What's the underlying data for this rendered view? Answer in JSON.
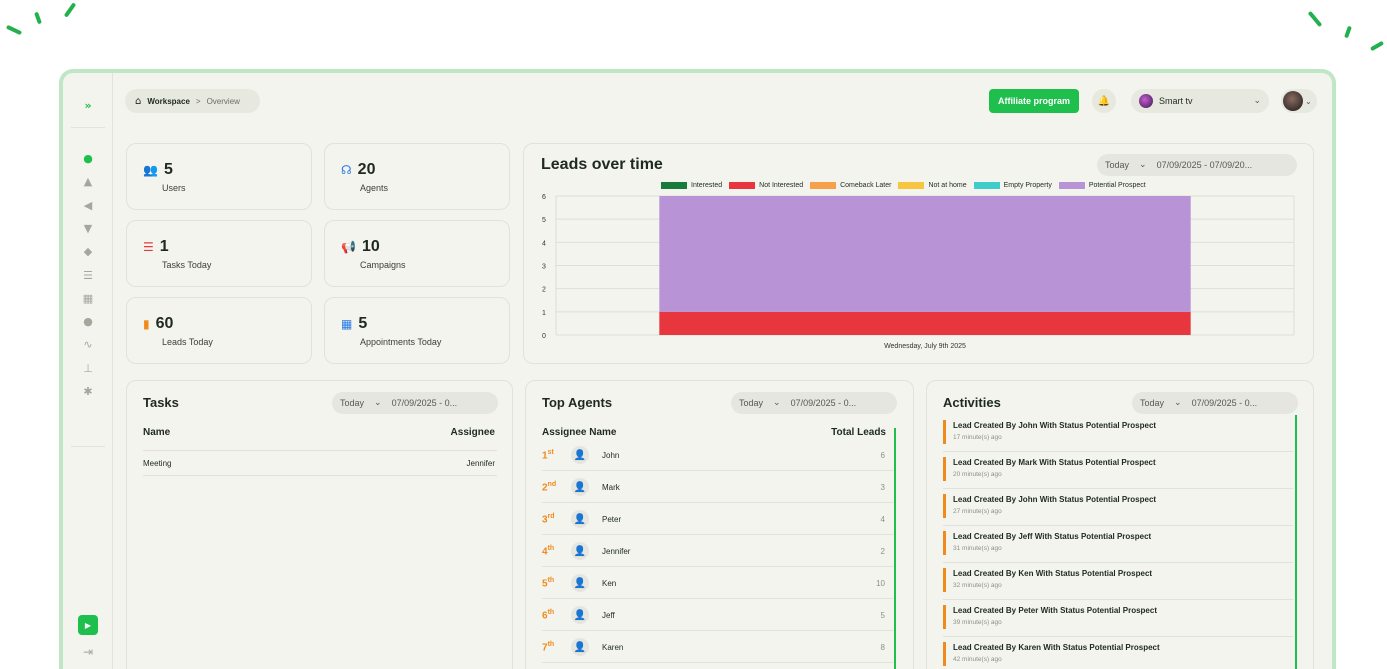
{
  "breadcrumb": {
    "workspace": "Workspace",
    "separator": ">",
    "page": "Overview",
    "icon": "home-icon"
  },
  "header": {
    "affiliate_label": "Affiliate program",
    "notification_icon": "bell-icon",
    "workspace_name": "Smart tv"
  },
  "colors": {
    "accent": "#1fbf4e",
    "rank": "#f08a1d",
    "activity_marker": "#f08a1d"
  },
  "stats": [
    {
      "value": "5",
      "label": "Users",
      "icon": "users-icon",
      "icon_glyph": "👥",
      "color": "#e0a11b"
    },
    {
      "value": "20",
      "label": "Agents",
      "icon": "headset-icon",
      "icon_glyph": "☊",
      "color": "#2b7be4"
    },
    {
      "value": "1",
      "label": "Tasks Today",
      "icon": "task-list-icon",
      "icon_glyph": "☰",
      "color": "#e23c3c"
    },
    {
      "value": "10",
      "label": "Campaigns",
      "icon": "megaphone-icon",
      "icon_glyph": "📢",
      "color": "#1b8a3b"
    },
    {
      "value": "60",
      "label": "Leads Today",
      "icon": "bar-chart-icon",
      "icon_glyph": "▮",
      "color": "#f08a1d"
    },
    {
      "value": "5",
      "label": "Appointments Today",
      "icon": "calendar-icon",
      "icon_glyph": "▦",
      "color": "#2b7be4"
    }
  ],
  "leads_chart": {
    "title": "Leads over time",
    "filter": {
      "period": "Today",
      "range": "07/09/2025 - 07/09/20..."
    }
  },
  "chart_data": {
    "type": "area",
    "title": "Leads over time",
    "xlabel": "",
    "ylabel": "",
    "ylim": [
      0,
      6
    ],
    "yticks": [
      "0",
      "1",
      "2",
      "3",
      "4",
      "5",
      "6"
    ],
    "categories": [
      "Wednesday, July 9th 2025"
    ],
    "stacked": true,
    "grid": true,
    "legend_position": "top",
    "series": [
      {
        "name": "Interested",
        "color": "#1a7a3c",
        "values": [
          0
        ]
      },
      {
        "name": "Not Interested",
        "color": "#e8363f",
        "values": [
          1
        ]
      },
      {
        "name": "Comeback Later",
        "color": "#f7a04a",
        "values": [
          0
        ]
      },
      {
        "name": "Not at home",
        "color": "#f6c640",
        "values": [
          0
        ]
      },
      {
        "name": "Empty Property",
        "color": "#3ecdc8",
        "values": [
          0
        ]
      },
      {
        "name": "Potential Prospect",
        "color": "#b893d6",
        "values": [
          5
        ]
      }
    ]
  },
  "tasks": {
    "title": "Tasks",
    "filter": {
      "period": "Today",
      "range": "07/09/2025 - 0..."
    },
    "columns": [
      "Name",
      "Assignee"
    ],
    "rows": [
      {
        "name": "Meeting",
        "assignee": "Jennifer"
      }
    ]
  },
  "top_agents": {
    "title": "Top Agents",
    "filter": {
      "period": "Today",
      "range": "07/09/2025 - 0..."
    },
    "columns": [
      "Assignee Name",
      "Total Leads"
    ],
    "rows": [
      {
        "rank": "1",
        "suffix": "st",
        "name": "John",
        "total": "6"
      },
      {
        "rank": "2",
        "suffix": "nd",
        "name": "Mark",
        "total": "3"
      },
      {
        "rank": "3",
        "suffix": "rd",
        "name": "Peter",
        "total": "4"
      },
      {
        "rank": "4",
        "suffix": "th",
        "name": "Jennifer",
        "total": "2"
      },
      {
        "rank": "5",
        "suffix": "th",
        "name": "Ken",
        "total": "10"
      },
      {
        "rank": "6",
        "suffix": "th",
        "name": "Jeff",
        "total": "5"
      },
      {
        "rank": "7",
        "suffix": "th",
        "name": "Karen",
        "total": "8"
      }
    ]
  },
  "activities": {
    "title": "Activities",
    "filter": {
      "period": "Today",
      "range": "07/09/2025 - 0..."
    },
    "items": [
      {
        "text": "Lead Created By John With Status Potential Prospect",
        "time": "17 minute(s) ago"
      },
      {
        "text": "Lead Created By Mark With Status Potential Prospect",
        "time": "20 minute(s) ago"
      },
      {
        "text": "Lead Created By John With Status Potential Prospect",
        "time": "27 minute(s) ago"
      },
      {
        "text": "Lead Created By Jeff With Status Potential Prospect",
        "time": "31 minute(s) ago"
      },
      {
        "text": "Lead Created By Ken With Status Potential Prospect",
        "time": "32 minute(s) ago"
      },
      {
        "text": "Lead Created By Peter With Status Potential Prospect",
        "time": "39 minute(s) ago"
      },
      {
        "text": "Lead Created By Karen With Status Potential Prospect",
        "time": "42 minute(s) ago"
      }
    ]
  },
  "sidebar": {
    "expand_icon": "»",
    "items": [
      {
        "name": "search-icon",
        "glyph": "●",
        "active": true
      },
      {
        "name": "contacts-icon",
        "glyph": "▲"
      },
      {
        "name": "campaign-icon",
        "glyph": "◀"
      },
      {
        "name": "filter-icon",
        "glyph": "▼"
      },
      {
        "name": "tag-icon",
        "glyph": "◆"
      },
      {
        "name": "list-icon",
        "glyph": "☰"
      },
      {
        "name": "calendar-icon",
        "glyph": "▦"
      },
      {
        "name": "map-pin-icon",
        "glyph": "●"
      },
      {
        "name": "route-icon",
        "glyph": "∿"
      },
      {
        "name": "hierarchy-icon",
        "glyph": "⊥"
      },
      {
        "name": "settings-icon",
        "glyph": "✱"
      }
    ],
    "bottom": [
      {
        "name": "youtube-icon",
        "glyph": "▶"
      },
      {
        "name": "logout-icon",
        "glyph": "⇥"
      }
    ]
  }
}
